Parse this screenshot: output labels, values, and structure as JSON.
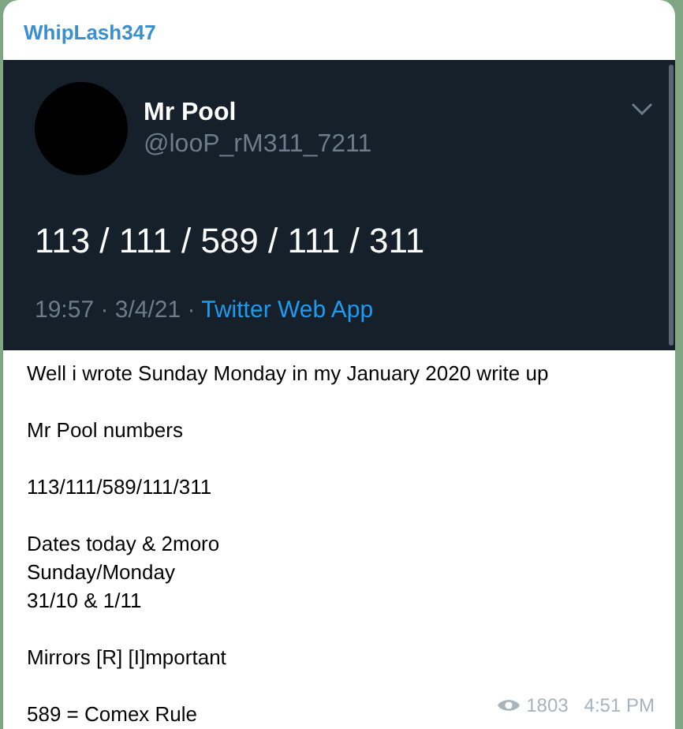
{
  "message": {
    "sender": "WhipLash347",
    "tweet": {
      "name": "Mr Pool",
      "handle": "@looP_rM311_7211",
      "text": "113 / 111 / 589 / 111 / 311",
      "meta": "19:57 · 3/4/21 · ",
      "source": "Twitter Web App"
    },
    "paragraphs": [
      [
        "Well i wrote Sunday Monday in my January 2020 write up"
      ],
      [
        "Mr Pool numbers"
      ],
      [
        "113/111/589/111/311"
      ],
      [
        "Dates today & 2moro",
        "Sunday/Monday",
        "31/10 & 1/11"
      ],
      [
        "Mirrors [R] [I]mportant"
      ],
      [
        "589 = Comex Rule"
      ]
    ],
    "views": "1803",
    "time": "4:51 PM"
  }
}
